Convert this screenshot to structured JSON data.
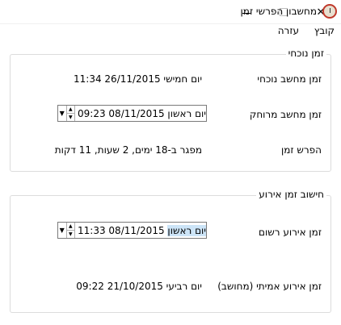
{
  "window": {
    "title": "מחשבון הפרשי זמן"
  },
  "menu": {
    "file": "קובץ",
    "help": "עזרה"
  },
  "current_time_group": {
    "title": "זמן נוכחי",
    "local_label": "זמן מחשב נוכחי",
    "local_value": "יום חמישי 26/11/2015 11:34",
    "remote_label": "זמן מחשב מרוחק",
    "remote_day": "יום ראשון",
    "remote_value": "08/11/2015 09:23",
    "diff_label": "הפרש זמן",
    "diff_value": "מפגר ב-18 ימים, 2 שעות, 11 דקות"
  },
  "event_group": {
    "title": "חישוב זמן אירוע",
    "recorded_label": "זמן אירוע רשום",
    "recorded_day": "יום ראשון",
    "recorded_value": "08/11/2015 11:33",
    "actual_label": "זמן אירוע אמיתי (מחושב)",
    "actual_value": "יום רביעי 21/10/2015 09:22"
  }
}
